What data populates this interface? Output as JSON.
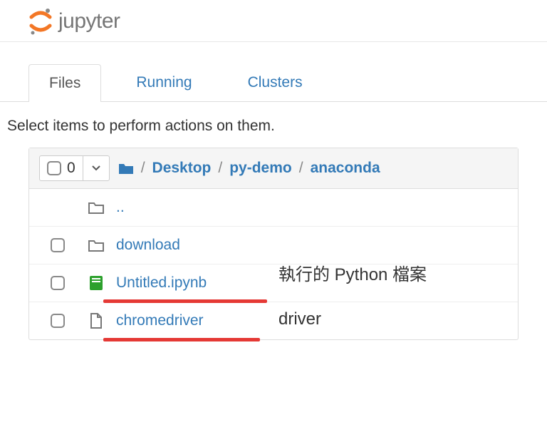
{
  "header": {
    "logo_text": "jupyter"
  },
  "tabs": [
    {
      "label": "Files",
      "active": true
    },
    {
      "label": "Running",
      "active": false
    },
    {
      "label": "Clusters",
      "active": false
    }
  ],
  "hint": "Select items to perform actions on them.",
  "selection": {
    "count": "0"
  },
  "breadcrumbs": [
    {
      "label": "Desktop"
    },
    {
      "label": "py-demo"
    },
    {
      "label": "anaconda"
    }
  ],
  "rows": [
    {
      "type": "up",
      "name": ".."
    },
    {
      "type": "folder",
      "name": "download"
    },
    {
      "type": "notebook",
      "name": "Untitled.ipynb",
      "running": true,
      "underline": true,
      "annotation": "執行的 Python 檔案"
    },
    {
      "type": "file",
      "name": "chromedriver",
      "underline": true,
      "annotation": "driver"
    }
  ]
}
